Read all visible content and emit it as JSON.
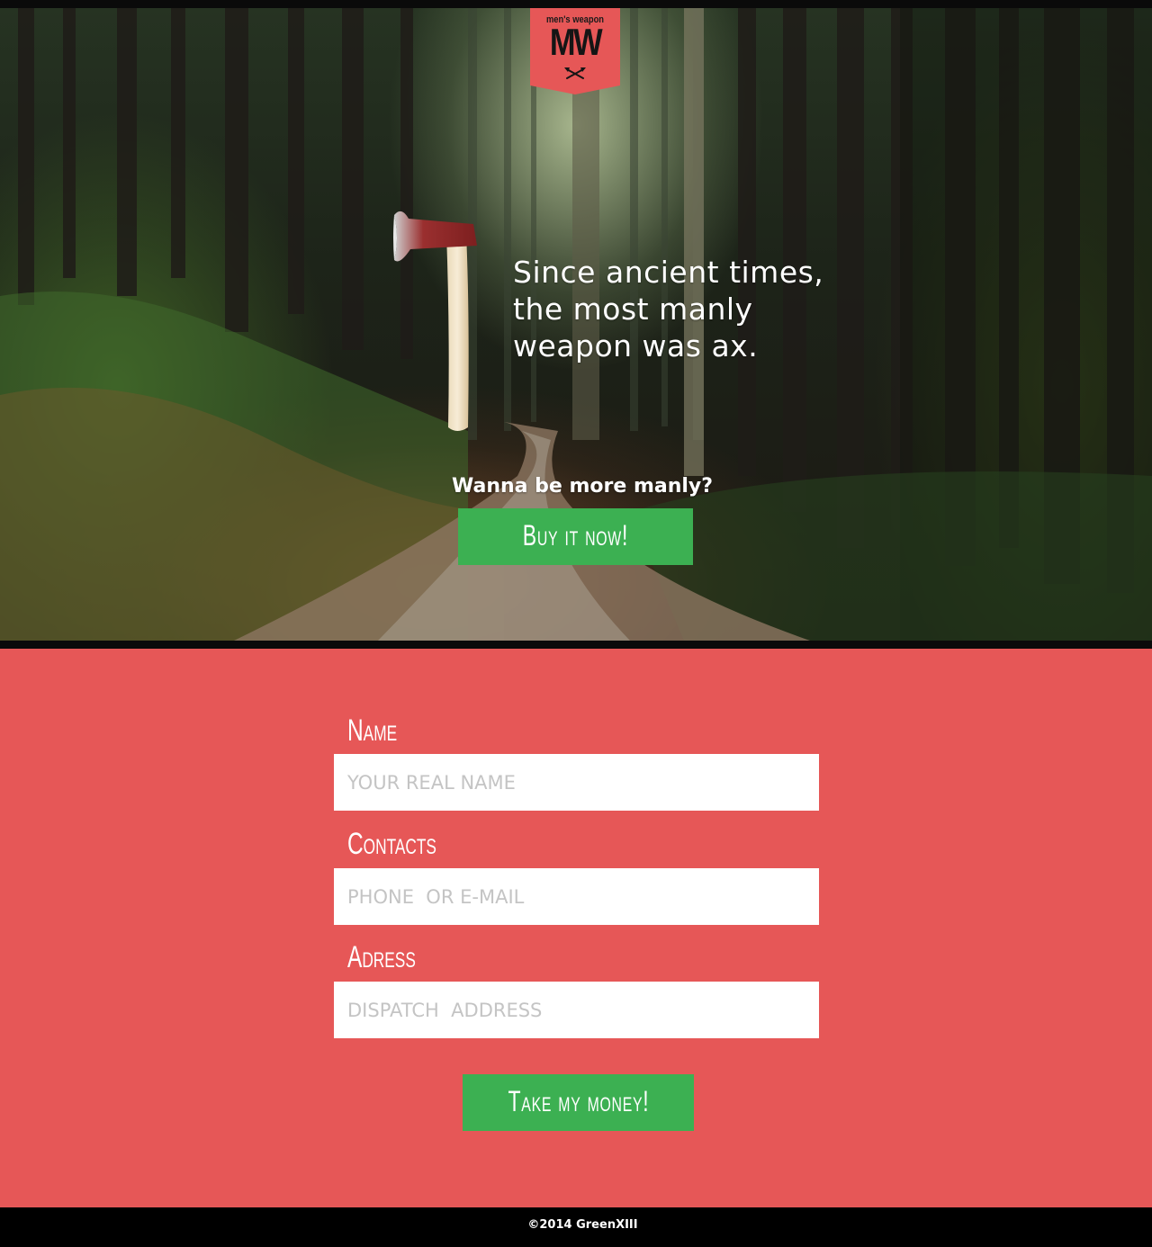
{
  "logo": {
    "subtitle": "men's weapon",
    "mark": "MW",
    "icon": "crossed-axes-icon"
  },
  "hero": {
    "tagline_lines": [
      "Since ancient times,",
      "the most manly",
      "weapon was ax."
    ],
    "question": "Wanna be more manly?",
    "buy_button": "Buy it now!",
    "image": "axe-illustration"
  },
  "form": {
    "fields": [
      {
        "label": "Name",
        "placeholder": "YOUR REAL NAME"
      },
      {
        "label": "Contacts",
        "placeholder": "PHONE  OR E-MAIL"
      },
      {
        "label": "Adress",
        "placeholder": "DISPATCH  ADDRESS"
      }
    ],
    "submit": "Take my money!"
  },
  "footer": {
    "copyright": "©2014 GreenXIII"
  },
  "colors": {
    "brand_red": "#e65757",
    "button_green": "#3cb052",
    "bar_black": "#0a0a0a"
  }
}
